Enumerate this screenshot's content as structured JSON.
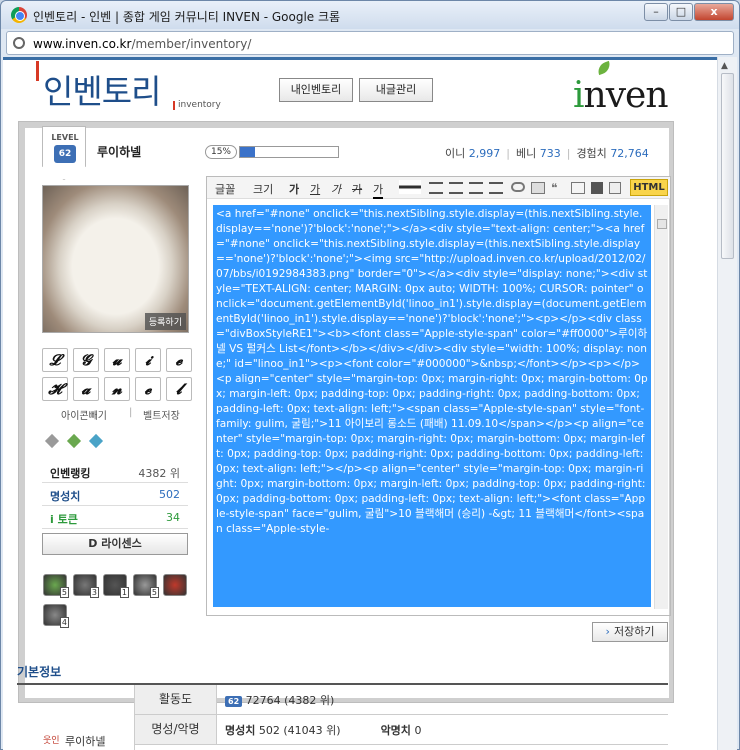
{
  "window": {
    "title": "인벤토리 - 인벤 | 종합 게임 커뮤니티 INVEN - Google 크롬",
    "min": "–",
    "max": "□",
    "close": "x"
  },
  "address": {
    "host": "www.inven.co.kr",
    "path": "/member/inventory/"
  },
  "header": {
    "logo": "인벤토리",
    "logo_sub": "inventory",
    "btn_my": "내인벤토리",
    "btn_posts": "내글관리",
    "brand": "nven",
    "brand_i": "i"
  },
  "profile": {
    "level_label": "LEVEL",
    "level": "62",
    "nickname": "루이하넬",
    "progress_pct": "15%",
    "progress": 0.15,
    "stats": [
      {
        "k": "이니",
        "v": "2,997"
      },
      {
        "k": "베니",
        "v": "733"
      },
      {
        "k": "경험치",
        "v": "72,764"
      }
    ],
    "register": "등록하기",
    "letters": [
      "𝓛",
      "𝓖",
      "𝓾",
      "𝓲",
      "𝓮",
      "𝓗",
      "𝓪",
      "𝓷",
      "𝓮",
      "𝓵"
    ],
    "link_icon": "아이콘빼기",
    "link_sep": "|",
    "link_belt": "벨트저장",
    "rank": [
      {
        "k": "인벤랭킹",
        "v": "4382 위",
        "kc": "#222"
      },
      {
        "k": "명성치",
        "v": "502",
        "kc": "#1e4e8a"
      },
      {
        "k": "i 토큰",
        "v": "34",
        "kc": "#2d9a3c"
      }
    ],
    "license": "D 라이센스",
    "badges": [
      {
        "n": "5",
        "c": "#6aa84f"
      },
      {
        "n": "3",
        "c": "#777"
      },
      {
        "n": "1",
        "c": "#555"
      },
      {
        "n": "5",
        "c": "#999"
      },
      {
        "n": "",
        "c": "#c0392b"
      },
      {
        "n": "4",
        "c": "#888"
      }
    ]
  },
  "editor": {
    "font": "글꼴",
    "size": "크기",
    "bold": "가",
    "underline": "가",
    "italic": "가",
    "strike": "가",
    "color": "가",
    "html_btn": "HTML",
    "code": "<a href=\"#none\" onclick=\"this.nextSibling.style.display=(this.nextSibling.style.display=='none')?'block':'none';\"></a><div style=\"text-align: center;\"><a href=\"#none\" onclick=\"this.nextSibling.style.display=(this.nextSibling.style.display=='none')?'block':'none';\"><img src=\"http://upload.inven.co.kr/upload/2012/02/07/bbs/i0192984383.png\" border=\"0\"></a><div style=\"display: none;\"><div style=\"TEXT-ALIGN: center; MARGIN: 0px auto; WIDTH: 100%; CURSOR: pointer\" onclick=\"document.getElementById('linoo_in1').style.display=(document.getElementById('linoo_in1').style.display=='none')?'block':'none';\"><p></p><div class=\"divBoxStyleRE1\"><b><font class=\"Apple-style-span\" color=\"#ff0000\">루이하넬 VS 펄커스 List</font></b></div></div><div style=\"width: 100%; display: none;\" id=\"linoo_in1\"><p><font color=\"#000000\">&nbsp;</font></p><p></p><p align=\"center\" style=\"margin-top: 0px; margin-right: 0px; margin-bottom: 0px; margin-left: 0px; padding-top: 0px; padding-right: 0px; padding-bottom: 0px; padding-left: 0px; text-align: left;\"><span class=\"Apple-style-span\" style=\"font-family: gulim, 굴림;\">11 아이보리 롱소드 (패배) 11.09.10</span></p><p align=\"center\" style=\"margin-top: 0px; margin-right: 0px; margin-bottom: 0px; margin-left: 0px; padding-top: 0px; padding-right: 0px; padding-bottom: 0px; padding-left: 0px; text-align: left;\"></p><p align=\"center\" style=\"margin-top: 0px; margin-right: 0px; margin-bottom: 0px; margin-left: 0px; padding-top: 0px; padding-right: 0px; padding-bottom: 0px; padding-left: 0px; text-align: left;\"><font class=\"Apple-style-span\" face=\"gulim, 굴림\">10 블랙해머 (승리) -&gt; 11 블랙해머</font><span class=\"Apple-style-"
  },
  "save": "저장하기",
  "basic": {
    "title": "기본정보",
    "rows": [
      {
        "k": "활동도",
        "v": "72764 (4382 위)",
        "lvl": "62"
      },
      {
        "k": "명성/악명",
        "v1k": "명성치",
        "v1": "502 (41043 위)",
        "v2k": "악명치",
        "v2": "0"
      }
    ],
    "name": "루이하넬"
  }
}
